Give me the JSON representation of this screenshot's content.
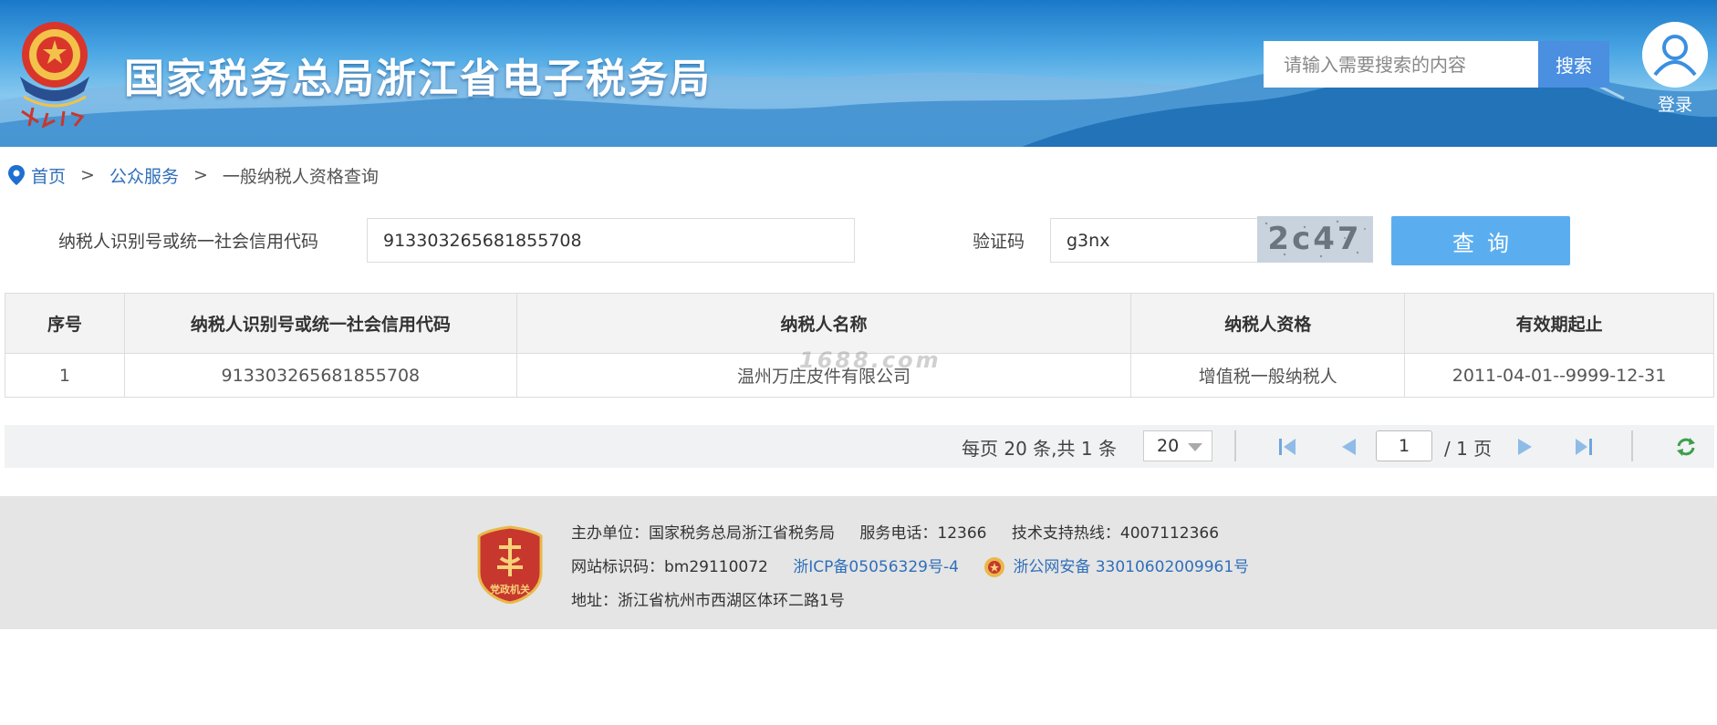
{
  "header": {
    "title": "国家税务总局浙江省电子税务局",
    "search_placeholder": "请输入需要搜索的内容",
    "search_button": "搜索",
    "login_label": "登录"
  },
  "breadcrumb": {
    "home": "首页",
    "sep1": ">",
    "section": "公众服务",
    "sep2": ">",
    "current": "一般纳税人资格查询"
  },
  "query": {
    "taxpayer_id_label": "纳税人识别号或统一社会信用代码",
    "taxpayer_id_value": "913303265681855708",
    "captcha_label": "验证码",
    "captcha_value": "g3nx",
    "captcha_image_text": "2c47",
    "query_button": "查询"
  },
  "table": {
    "headers": [
      "序号",
      "纳税人识别号或统一社会信用代码",
      "纳税人名称",
      "纳税人资格",
      "有效期起止"
    ],
    "rows": [
      [
        "1",
        "913303265681855708",
        "温州万庄皮件有限公司",
        "增值税一般纳税人",
        "2011-04-01--9999-12-31"
      ]
    ],
    "watermark": "1688.com"
  },
  "pager": {
    "summary": "每页 20 条,共 1 条",
    "page_size": "20",
    "current_page": "1",
    "total_pages": "/ 1 页"
  },
  "footer": {
    "host": "主办单位：国家税务总局浙江省税务局",
    "phone": "服务电话：12366",
    "hotline": "技术支持热线：4007112366",
    "site_code": "网站标识码：bm29110072",
    "icp": "浙ICP备05056329号-4",
    "police": "浙公网安备 33010602009961号",
    "address": "地址：浙江省杭州市西湖区体环二路1号",
    "badge_text": "党政机关"
  },
  "colors": {
    "accent": "#4a8fe0",
    "query_button": "#5aaef0",
    "link": "#2f6fba",
    "footer_bg": "#e5e5e5",
    "badge_red": "#c8372d"
  }
}
